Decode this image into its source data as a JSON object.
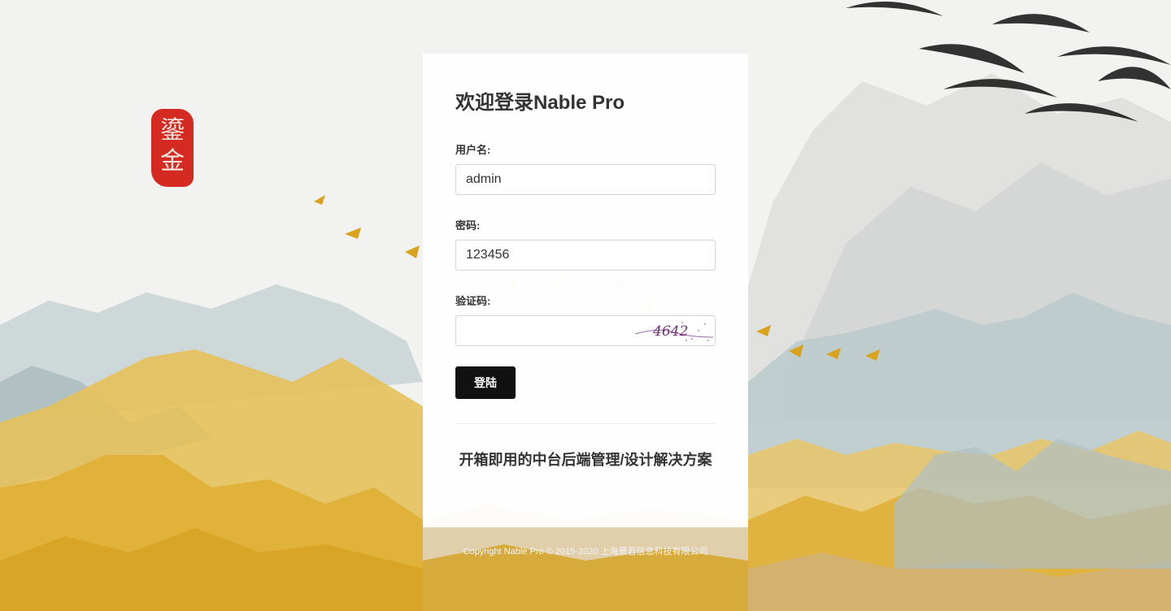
{
  "seal": {
    "text_top": "鎏",
    "text_bottom": "金"
  },
  "login": {
    "title": "欢迎登录Nable Pro",
    "username_label": "用户名:",
    "username_value": "admin",
    "password_label": "密码:",
    "password_value": "123456",
    "captcha_label": "验证码:",
    "captcha_value": "",
    "captcha_image_text": "4642",
    "submit_label": "登陆",
    "slogan": "开箱即用的中台后端管理/设计解决方案"
  },
  "footer": {
    "copyright": "Copyright Nable Pro © 2015-2020 上海景若信息科技有限公司"
  },
  "colors": {
    "seal": "#d42a22",
    "gold": "#e2b43c",
    "button": "#111111",
    "mountain": "#b9c9c9"
  }
}
